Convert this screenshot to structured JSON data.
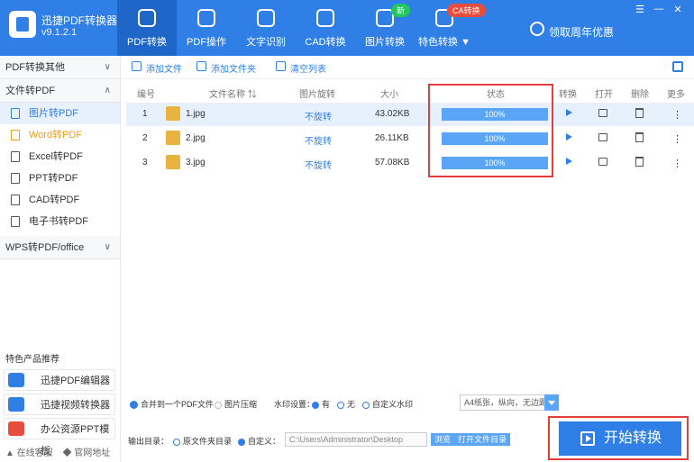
{
  "app": {
    "name": "迅捷PDF转换器",
    "version": "v9.1.2.1"
  },
  "nav": [
    {
      "label": "PDF转换",
      "active": true
    },
    {
      "label": "PDF操作"
    },
    {
      "label": "文字识别"
    },
    {
      "label": "CAD转换"
    },
    {
      "label": "图片转换",
      "badge": "新"
    },
    {
      "label": "特色转换 ▼",
      "badge": "CA转换"
    }
  ],
  "promo": "领取周年优惠",
  "window_controls": {
    "menu": "☰",
    "min": "—",
    "close": "✕"
  },
  "sidebar": {
    "groups": [
      {
        "label": "PDF转换其他",
        "chev": "∨"
      },
      {
        "label": "文件转PDF",
        "chev": "∧"
      },
      {
        "label": "WPS转PDF/office",
        "chev": "∨"
      }
    ],
    "items": [
      {
        "label": "图片转PDF",
        "active": true
      },
      {
        "label": "Word转PDF"
      },
      {
        "label": "Excel转PDF"
      },
      {
        "label": "PPT转PDF"
      },
      {
        "label": "CAD转PDF"
      },
      {
        "label": "电子书转PDF"
      }
    ],
    "rec_title": "特色产品推荐",
    "rec": [
      {
        "label": "迅捷PDF编辑器"
      },
      {
        "label": "迅捷视频转换器"
      },
      {
        "label": "办公资源PPT模板"
      }
    ],
    "footer": {
      "service": "▲ 在线客服",
      "site": "◆ 官网地址"
    }
  },
  "toolbar": {
    "add_file": "添加文件",
    "add_folder": "添加文件夹",
    "clear": "清空列表"
  },
  "table": {
    "headers": {
      "num": "编号",
      "name": "文件名称 ⇅",
      "rotate": "图片旋转",
      "size": "大小",
      "status": "状态",
      "convert": "转换",
      "open": "打开",
      "delete": "删除",
      "more": "更多"
    },
    "rows": [
      {
        "num": "1",
        "name": "1.jpg",
        "rotate": "不旋转",
        "size": "43.02KB",
        "status": "100%",
        "more": "⋮"
      },
      {
        "num": "2",
        "name": "2.jpg",
        "rotate": "不旋转",
        "size": "26.11KB",
        "status": "100%",
        "more": "⋮"
      },
      {
        "num": "3",
        "name": "3.jpg",
        "rotate": "不旋转",
        "size": "57.08KB",
        "status": "100%",
        "more": "⋮"
      }
    ]
  },
  "options": {
    "merge": "合并到一个PDF文件",
    "compress": "图片压缩",
    "watermark_label": "水印设置：",
    "wm_yes": "有",
    "wm_no": "无",
    "wm_custom": "自定义水印",
    "paper": "A4纸张，纵向，无边距"
  },
  "output": {
    "label": "输出目录：",
    "orig": "原文件夹目录",
    "custom": "自定义：",
    "path": "C:\\Users\\Administrator\\Desktop",
    "browse": "浏览",
    "open_dir": "打开文件目录"
  },
  "start": "开始转换"
}
